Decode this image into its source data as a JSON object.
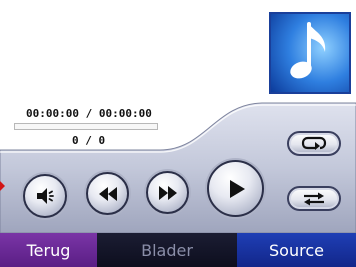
{
  "player": {
    "time_display": "00:00:00 / 00:00:00",
    "track_counter": "0 / 0",
    "progress": 0
  },
  "album_art": {
    "icon": "music-note-icon"
  },
  "controls": {
    "volume_icon": "speaker-icon",
    "rewind_icon": "rewind-icon",
    "fastforward_icon": "fast-forward-icon",
    "play_icon": "play-icon",
    "repeat_icon": "repeat-icon",
    "shuffle_icon": "shuffle-icon"
  },
  "nav": {
    "back_label": "Terug",
    "browse_label": "Blader",
    "source_label": "Source"
  },
  "colors": {
    "panel": "#c5c9da",
    "back": "#6a2a98",
    "browse": "#141628",
    "source": "#1a33a0",
    "album_art_bg": "#0a2d82"
  }
}
